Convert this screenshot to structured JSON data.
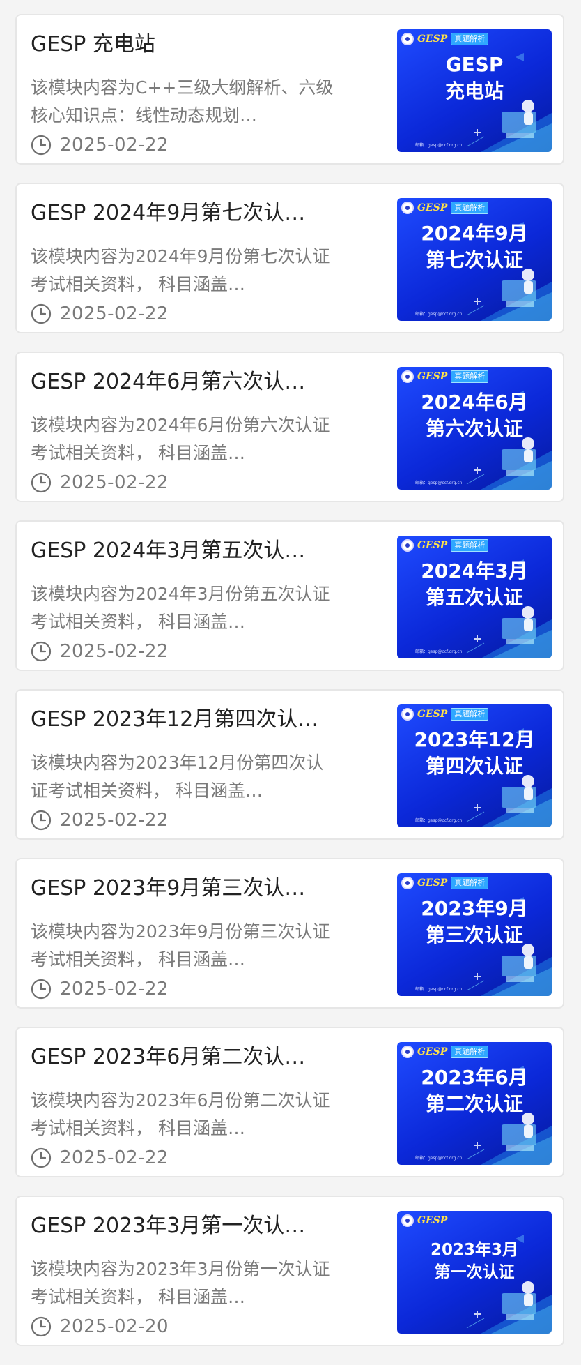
{
  "colors": {
    "background": "#f4f4f4",
    "card_border": "#e6e6e6",
    "title_text": "#222222",
    "secondary_text": "#7a7a7a",
    "thumb_blue": "#0b28d8",
    "thumb_brand": "#ffe24a"
  },
  "icons": {
    "date": "clock-icon"
  },
  "cards": [
    {
      "title": "GESP 充电站",
      "desc": "该模块内容为C++三级大纲解析、六级核心知识点：线性动态规划…",
      "date": "2025-02-22",
      "thumb": {
        "brand": "GESP",
        "tag": "真题解析",
        "line1": "GESP",
        "line2": "充电站",
        "footer": "邮箱：gesp@ccf.org.cn"
      }
    },
    {
      "title": "GESP 2024年9月第七次认…",
      "desc": "该模块内容为2024年9月份第七次认证考试相关资料， 科目涵盖…",
      "date": "2025-02-22",
      "thumb": {
        "brand": "GESP",
        "tag": "真题解析",
        "line1": "2024年9月",
        "line2": "第七次认证",
        "footer": "邮箱：gesp@ccf.org.cn"
      }
    },
    {
      "title": "GESP 2024年6月第六次认…",
      "desc": "该模块内容为2024年6月份第六次认证考试相关资料， 科目涵盖…",
      "date": "2025-02-22",
      "thumb": {
        "brand": "GESP",
        "tag": "真题解析",
        "line1": "2024年6月",
        "line2": "第六次认证",
        "footer": "邮箱：gesp@ccf.org.cn"
      }
    },
    {
      "title": "GESP 2024年3月第五次认…",
      "desc": "该模块内容为2024年3月份第五次认证考试相关资料， 科目涵盖…",
      "date": "2025-02-22",
      "thumb": {
        "brand": "GESP",
        "tag": "真题解析",
        "line1": "2024年3月",
        "line2": "第五次认证",
        "footer": "邮箱：gesp@ccf.org.cn"
      }
    },
    {
      "title": "GESP 2023年12月第四次认…",
      "desc": "该模块内容为2023年12月份第四次认证考试相关资料， 科目涵盖…",
      "date": "2025-02-22",
      "thumb": {
        "brand": "GESP",
        "tag": "真题解析",
        "line1": "2023年12月",
        "line2": "第四次认证",
        "footer": "邮箱：gesp@ccf.org.cn"
      }
    },
    {
      "title": "GESP 2023年9月第三次认…",
      "desc": "该模块内容为2023年9月份第三次认证考试相关资料， 科目涵盖…",
      "date": "2025-02-22",
      "thumb": {
        "brand": "GESP",
        "tag": "真题解析",
        "line1": "2023年9月",
        "line2": "第三次认证",
        "footer": "邮箱：gesp@ccf.org.cn"
      }
    },
    {
      "title": "GESP 2023年6月第二次认…",
      "desc": "该模块内容为2023年6月份第二次认证考试相关资料， 科目涵盖…",
      "date": "2025-02-22",
      "thumb": {
        "brand": "GESP",
        "tag": "真题解析",
        "line1": "2023年6月",
        "line2": "第二次认证",
        "footer": "邮箱：gesp@ccf.org.cn"
      }
    },
    {
      "title": "GESP 2023年3月第一次认…",
      "desc": "该模块内容为2023年3月份第一次认证考试相关资料， 科目涵盖…",
      "date": "2025-02-20",
      "thumb": {
        "brand": "GESP",
        "tag": "",
        "line1": "2023年3月",
        "line2": "第一次认证",
        "footer": ""
      }
    }
  ]
}
